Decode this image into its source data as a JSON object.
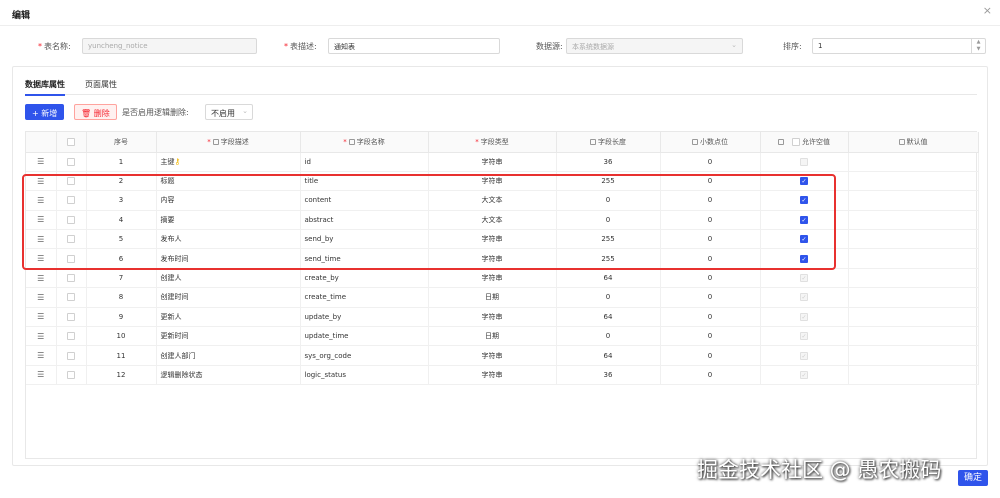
{
  "modal": {
    "title": "编辑",
    "close": "×"
  },
  "form": {
    "table_name_label": "表名称:",
    "table_name_value": "yuncheng_notice",
    "table_desc_label": "表描述:",
    "table_desc_value": "通知表",
    "datasource_label": "数据源:",
    "datasource_value": "本系统数据源",
    "sort_label": "排序:",
    "sort_value": "1"
  },
  "tabs": [
    {
      "label": "数据库属性",
      "active": true
    },
    {
      "label": "页面属性",
      "active": false
    }
  ],
  "toolbar": {
    "add_label": "+ 新增",
    "delete_label": "删除",
    "logic_delete_label": "是否启用逻辑删除:",
    "logic_delete_value": "不启用"
  },
  "table": {
    "headers": [
      "序号",
      "字段描述",
      "字段名称",
      "字段类型",
      "字段长度",
      "小数点位",
      "允许空值",
      "默认值"
    ],
    "rows": [
      {
        "no": "1",
        "desc": "主键",
        "name": "id",
        "type": "字符串",
        "length": "36",
        "decimal": "0",
        "nullable": "disabled"
      },
      {
        "no": "2",
        "desc": "标题",
        "name": "title",
        "type": "字符串",
        "length": "255",
        "decimal": "0",
        "nullable": "checked"
      },
      {
        "no": "3",
        "desc": "内容",
        "name": "content",
        "type": "大文本",
        "length": "0",
        "decimal": "0",
        "nullable": "checked"
      },
      {
        "no": "4",
        "desc": "摘要",
        "name": "abstract",
        "type": "大文本",
        "length": "0",
        "decimal": "0",
        "nullable": "checked"
      },
      {
        "no": "5",
        "desc": "发布人",
        "name": "send_by",
        "type": "字符串",
        "length": "255",
        "decimal": "0",
        "nullable": "checked"
      },
      {
        "no": "6",
        "desc": "发布时间",
        "name": "send_time",
        "type": "字符串",
        "length": "255",
        "decimal": "0",
        "nullable": "checked"
      },
      {
        "no": "7",
        "desc": "创建人",
        "name": "create_by",
        "type": "字符串",
        "length": "64",
        "decimal": "0",
        "nullable": "disabled-checked"
      },
      {
        "no": "8",
        "desc": "创建时间",
        "name": "create_time",
        "type": "日期",
        "length": "0",
        "decimal": "0",
        "nullable": "disabled-checked"
      },
      {
        "no": "9",
        "desc": "更新人",
        "name": "update_by",
        "type": "字符串",
        "length": "64",
        "decimal": "0",
        "nullable": "disabled-checked"
      },
      {
        "no": "10",
        "desc": "更新时间",
        "name": "update_time",
        "type": "日期",
        "length": "0",
        "decimal": "0",
        "nullable": "disabled-checked"
      },
      {
        "no": "11",
        "desc": "创建人部门",
        "name": "sys_org_code",
        "type": "字符串",
        "length": "64",
        "decimal": "0",
        "nullable": "disabled-checked"
      },
      {
        "no": "12",
        "desc": "逻辑删除状态",
        "name": "logic_status",
        "type": "字符串",
        "length": "36",
        "decimal": "0",
        "nullable": "disabled-checked"
      }
    ]
  },
  "watermark": "掘金技术社区 @ 愚农搬码",
  "confirm_label": "确定",
  "colors": {
    "primary": "#2f54eb",
    "highlight": "#e8312f",
    "danger": "#f5222d"
  }
}
